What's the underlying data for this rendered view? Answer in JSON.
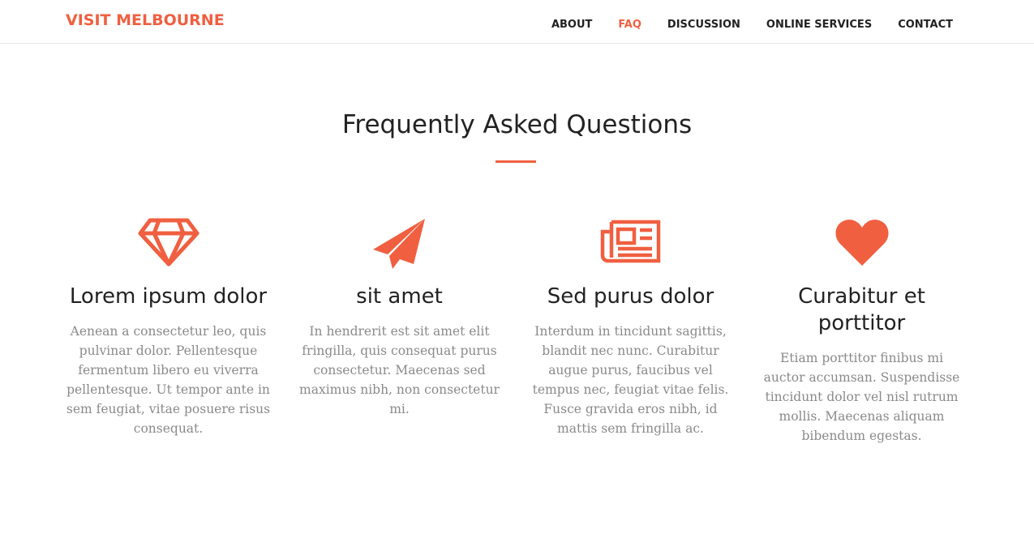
{
  "brand": {
    "label": "VISIT MELBOURNE",
    "color": "#f05f40"
  },
  "nav": {
    "items": [
      {
        "label": "ABOUT",
        "active": false
      },
      {
        "label": "FAQ",
        "active": true
      },
      {
        "label": "DISCUSSION",
        "active": false
      },
      {
        "label": "ONLINE SERVICES",
        "active": false
      },
      {
        "label": "CONTACT",
        "active": false
      }
    ]
  },
  "section": {
    "title": "Frequently Asked Questions",
    "accent_color": "#f05f40"
  },
  "features": [
    {
      "icon": "diamond-icon",
      "title": "Lorem ipsum dolor",
      "text": "Aenean a consectetur leo, quis pulvinar dolor. Pellentesque fermentum libero eu viverra pellentesque. Ut tempor ante in sem feugiat, vitae posuere risus consequat."
    },
    {
      "icon": "paper-plane-icon",
      "title": "sit amet",
      "text": "In hendrerit est sit amet elit fringilla, quis consequat purus consectetur. Maecenas sed maximus nibh, non consectetur mi."
    },
    {
      "icon": "newspaper-icon",
      "title": "Sed purus dolor",
      "text": "Interdum in tincidunt sagittis, blandit nec nunc. Curabitur augue purus, faucibus vel tempus nec, feugiat vitae felis. Fusce gravida eros nibh, id mattis sem fringilla ac."
    },
    {
      "icon": "heart-icon",
      "title": "Curabitur et porttitor",
      "text": "Etiam porttitor finibus mi auctor accumsan. Suspendisse tincidunt dolor vel nisl rutrum mollis. Maecenas aliquam bibendum egestas."
    }
  ]
}
